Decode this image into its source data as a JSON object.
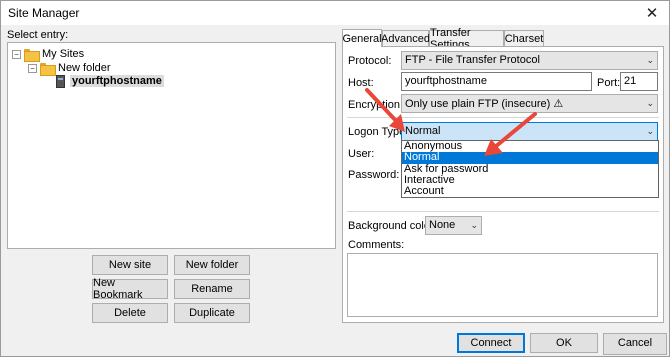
{
  "window": {
    "title": "Site Manager",
    "close_glyph": "✕"
  },
  "left": {
    "select_entry_label": "Select entry:",
    "tree": [
      {
        "label": "My Sites",
        "expander": "−"
      },
      {
        "label": "New folder",
        "expander": "−"
      },
      {
        "label": "yourftphostname"
      }
    ],
    "buttons": {
      "new_site": "New site",
      "new_folder": "New folder",
      "new_bookmark": "New Bookmark",
      "rename": "Rename",
      "delete": "Delete",
      "duplicate": "Duplicate"
    }
  },
  "tabs": [
    "General",
    "Advanced",
    "Transfer Settings",
    "Charset"
  ],
  "general": {
    "protocol_label": "Protocol:",
    "protocol_value": "FTP - File Transfer Protocol",
    "host_label": "Host:",
    "host_value": "yourftphostname",
    "port_label": "Port:",
    "port_value": "21",
    "encryption_label": "Encryption:",
    "encryption_value": "Only use plain FTP (insecure) ⚠",
    "logon_type_label": "Logon Type:",
    "logon_type_value": "Normal",
    "logon_options": [
      "Anonymous",
      "Normal",
      "Ask for password",
      "Interactive",
      "Account"
    ],
    "user_label": "User:",
    "password_label": "Password:",
    "bg_color_label": "Background color:",
    "bg_color_value": "None",
    "comments_label": "Comments:"
  },
  "footer": {
    "connect": "Connect",
    "ok": "OK",
    "cancel": "Cancel"
  },
  "colors": {
    "accent": "#0078d7",
    "annotation_arrow": "#e8473a"
  }
}
